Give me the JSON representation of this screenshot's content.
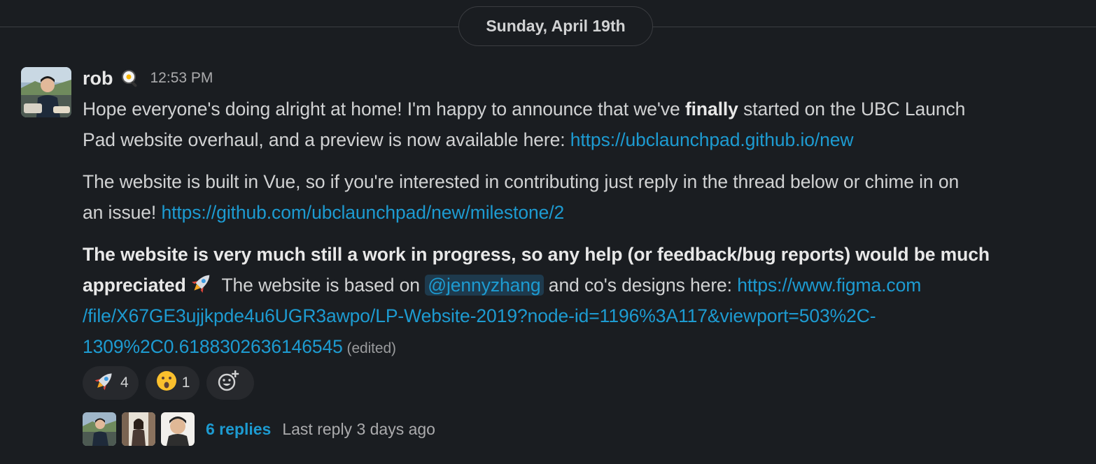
{
  "divider": {
    "date_label": "Sunday, April 19th"
  },
  "message": {
    "author": "rob",
    "status_emoji": "frying-pan-egg",
    "timestamp": "12:53 PM",
    "p1": {
      "text_a": "Hope everyone's doing alright at home! I'm happy to announce that we've ",
      "bold": "finally",
      "text_b": " started on the UBC Launch",
      "text_c": "Pad website overhaul, and a preview is now available here: ",
      "link": "https://ubclaunchpad.github.io/new"
    },
    "p2": {
      "text_a": "The website is built in Vue, so if you're interested in contributing just reply in the thread below or chime in on",
      "text_b": "an issue! ",
      "link": "https://github.com/ubclaunchpad/new/milestone/2"
    },
    "p3": {
      "bold_a": "The website is very much still a work in progress, so any help (or feedback/bug reports) would be much",
      "bold_b": "appreciated",
      "emoji": "rocket",
      "text_a": " The website is based on ",
      "mention": "@jennyzhang",
      "text_b": " and co's designs here: ",
      "link_a": "https://www.figma.com",
      "link_b": "/file/X67GE3ujjkpde4u6UGR3awpo/LP-Website-2019?node-id=1196%3A117&viewport=503%2C-",
      "link_c": "1309%2C0.6188302636146545",
      "edited": " (edited)"
    },
    "reactions": [
      {
        "emoji": "rocket",
        "count": "4"
      },
      {
        "emoji": "hushed-face",
        "count": "1"
      }
    ],
    "add_reaction_icon": "add-reaction-icon",
    "thread": {
      "replies": "6 replies",
      "last_reply": "Last reply 3 days ago"
    }
  },
  "colors": {
    "background": "#1a1d21",
    "link": "#1d9bd1",
    "text": "#d1d2d3",
    "pill": "#27292d"
  }
}
